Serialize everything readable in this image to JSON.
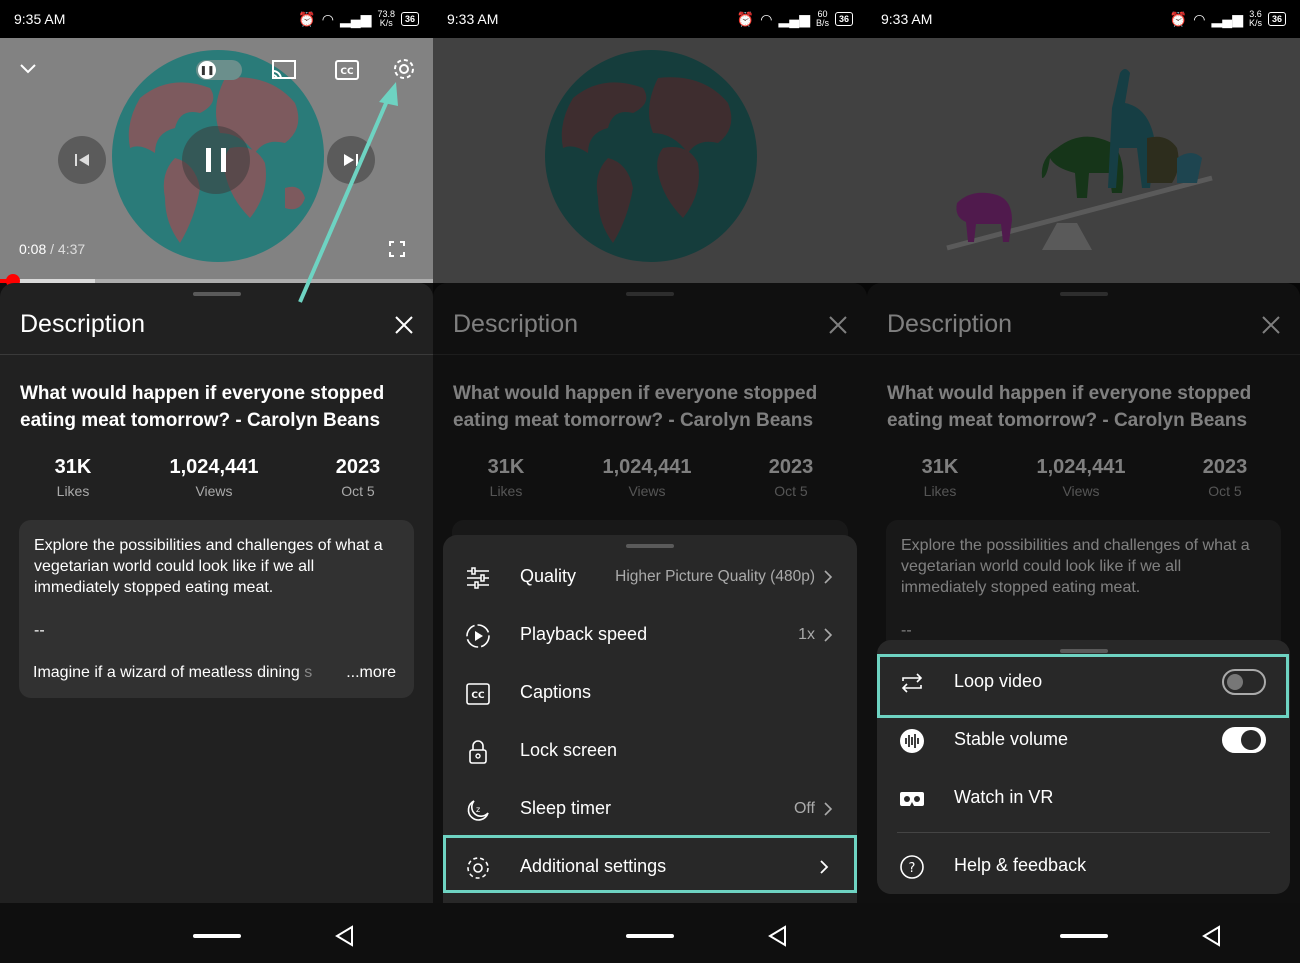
{
  "panels": [
    {
      "status": {
        "time": "9:35 AM",
        "speed_top": "73.8",
        "speed_bottom": "K/s",
        "battery": "36"
      },
      "player": {
        "current_time": "0:08",
        "total_time": "/ 4:37",
        "progress": 0.022,
        "loaded": 0.22
      },
      "sheet": {
        "title": "Description"
      }
    },
    {
      "status": {
        "time": "9:33 AM",
        "speed_top": "60",
        "speed_bottom": "B/s",
        "battery": "36"
      },
      "sheet": {
        "title": "Description"
      }
    },
    {
      "status": {
        "time": "9:33 AM",
        "speed_top": "3.6",
        "speed_bottom": "K/s",
        "battery": "36"
      },
      "sheet": {
        "title": "Description"
      }
    }
  ],
  "video": {
    "title": "What would happen if everyone stopped eating meat tomorrow? - Carolyn Beans",
    "likes": "31K",
    "likes_label": "Likes",
    "views": "1,024,441",
    "views_label": "Views",
    "year": "2023",
    "date": "Oct 5",
    "description": "Explore the possibilities and challenges of what a vegetarian world could look like if we all immediately stopped eating meat.",
    "desc_dash": "--",
    "desc_more_line": "Imagine if a wizard of meatless dining ",
    "desc_more_fade": "s",
    "more_label": "...more"
  },
  "settings_menu": {
    "items": [
      {
        "label": "Quality",
        "value": "Higher Picture Quality (480p)",
        "icon": "sliders-icon"
      },
      {
        "label": "Playback speed",
        "value": "1x",
        "icon": "playback-speed-icon"
      },
      {
        "label": "Captions",
        "value": "",
        "icon": "cc-icon"
      },
      {
        "label": "Lock screen",
        "value": "",
        "icon": "lock-icon"
      },
      {
        "label": "Sleep timer",
        "value": "Off",
        "icon": "sleep-timer-icon"
      },
      {
        "label": "Additional settings",
        "value": "",
        "icon": "gear-icon"
      }
    ]
  },
  "additional_menu": {
    "items": [
      {
        "label": "Loop video",
        "icon": "loop-icon",
        "toggle": "off"
      },
      {
        "label": "Stable volume",
        "icon": "stable-volume-icon",
        "toggle": "on"
      },
      {
        "label": "Watch in VR",
        "icon": "vr-icon"
      },
      {
        "label": "Help & feedback",
        "icon": "help-icon"
      }
    ]
  },
  "colors": {
    "highlight": "#6ed3c2",
    "progress": "#ff0000",
    "globe": "#2a7b79",
    "land": "#7d5a5e"
  }
}
